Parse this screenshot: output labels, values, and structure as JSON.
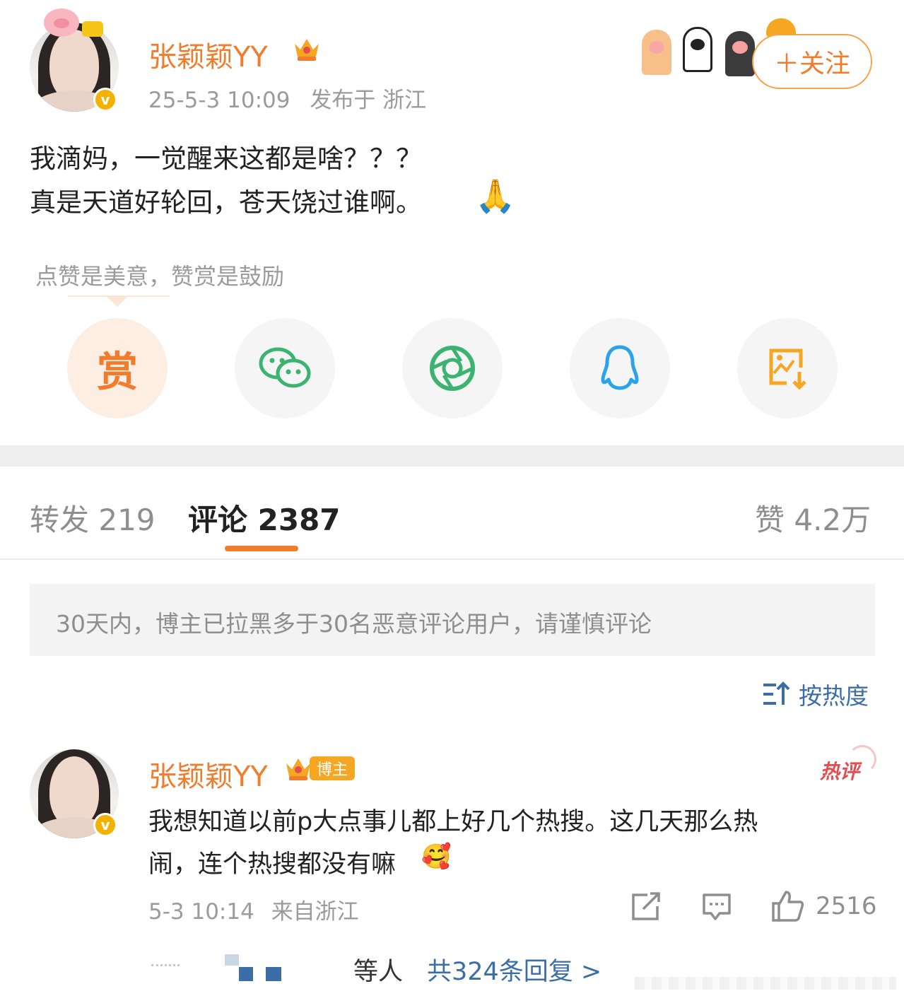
{
  "post": {
    "author": "张颖颖YY",
    "time": "25-5-3 10:09",
    "location": "发布于 浙江",
    "follow_label": "＋关注",
    "lines": [
      "我滴妈，一觉醒来这都是啥？？？",
      "真是天道好轮回，苍天饶过谁啊。"
    ],
    "emoji": "🙏",
    "verified_mark": "v"
  },
  "reward_tip": "点赞是美意，赞赏是鼓励",
  "share": {
    "reward_label": "赏",
    "icons": [
      "reward-icon",
      "wechat-icon",
      "moments-icon",
      "qq-icon",
      "save-image-icon"
    ]
  },
  "tabs": {
    "repost": "转发 219",
    "comment": "评论 2387",
    "like": "赞 4.2万"
  },
  "notice": "30天内，博主已拉黑多于30名恶意评论用户，请谨慎评论",
  "sort_label": "按热度",
  "comment": {
    "author": "张颖颖YY",
    "host_badge": "博主",
    "hot_label": "热评",
    "text_lines": [
      "我想知道以前p大点事儿都上好几个热搜。这几天那么热",
      "闹，连个热搜都没有嘛"
    ],
    "emoji": "🥰",
    "time": "5-3 10:14",
    "location": "来自浙江",
    "like_count": "2516",
    "replies_prefix": "等人",
    "replies_link": "共324条回复 >",
    "verified_mark": "v"
  },
  "colors": {
    "accent": "#f07c2c",
    "link": "#3b6ea7",
    "muted": "#9b9b9b",
    "hot": "#e34d4d"
  }
}
